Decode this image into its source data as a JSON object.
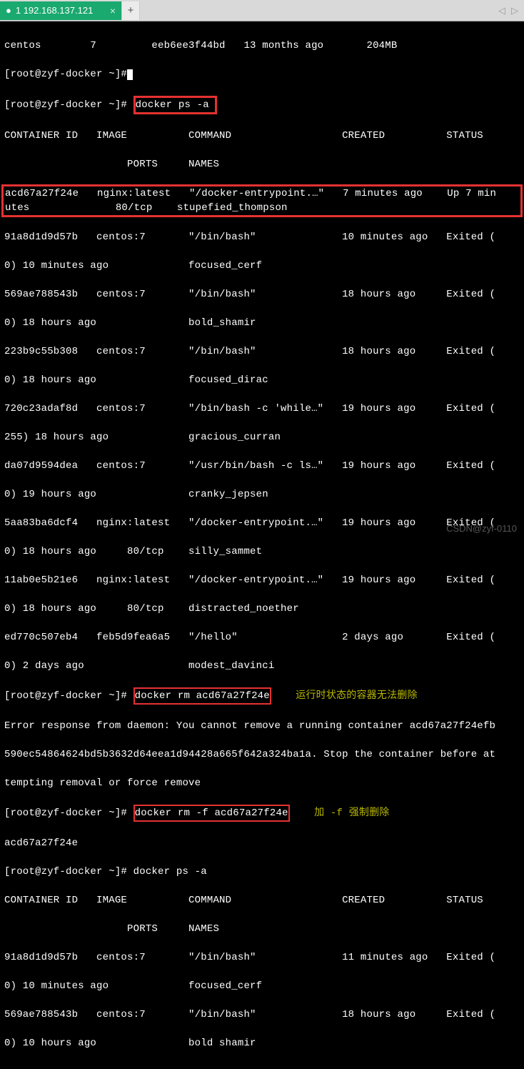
{
  "tab_bar": {
    "active_tab_label": "1 192.168.137.121",
    "add_button": "+",
    "arrow_left": "◁",
    "arrow_right": "▷"
  },
  "terminal": {
    "line_centos": "centos        7         eeb6ee3f44bd   13 months ago       204MB",
    "prompt_idle": "[root@zyf-docker ~]#",
    "cmd_ps_a_boxed": "docker ps -a",
    "header1": "CONTAINER ID   IMAGE          COMMAND                  CREATED          STATUS",
    "header2": "                    PORTS     NAMES",
    "row_hl_a": "acd67a27f24e   nginx:latest   \"/docker-entrypoint.…\"   7 minutes ago    Up 7 min",
    "row_hl_b": "utes              80/tcp    stupefied_thompson",
    "rows_a": [
      "91a8d1d9d57b   centos:7       \"/bin/bash\"              10 minutes ago   Exited (",
      "0) 10 minutes ago             focused_cerf",
      "569ae788543b   centos:7       \"/bin/bash\"              18 hours ago     Exited (",
      "0) 18 hours ago               bold_shamir",
      "223b9c55b308   centos:7       \"/bin/bash\"              18 hours ago     Exited (",
      "0) 18 hours ago               focused_dirac",
      "720c23adaf8d   centos:7       \"/bin/bash -c 'while…\"   19 hours ago     Exited (",
      "255) 18 hours ago             gracious_curran",
      "da07d9594dea   centos:7       \"/usr/bin/bash -c ls…\"   19 hours ago     Exited (",
      "0) 19 hours ago               cranky_jepsen",
      "5aa83ba6dcf4   nginx:latest   \"/docker-entrypoint.…\"   19 hours ago     Exited (",
      "0) 18 hours ago     80/tcp    silly_sammet",
      "11ab0e5b21e6   nginx:latest   \"/docker-entrypoint.…\"   19 hours ago     Exited (",
      "0) 18 hours ago     80/tcp    distracted_noether",
      "ed770c507eb4   feb5d9fea6a5   \"/hello\"                 2 days ago       Exited (",
      "0) 2 days ago                 modest_davinci"
    ],
    "prompt_rm": "[root@zyf-docker ~]# ",
    "cmd_rm_boxed": "docker rm acd67a27f24e",
    "annot_rm_cn": "运行时状态的容器无法删除",
    "error_lines": [
      "Error response from daemon: You cannot remove a running container acd67a27f24efb",
      "590ec54864624bd5b3632d64eea1d94428a665f642a324ba1a. Stop the container before at",
      "tempting removal or force remove"
    ],
    "prompt_rm_f": "[root@zyf-docker ~]# ",
    "cmd_rm_f_boxed": "docker rm -f acd67a27f24e",
    "annot_rm_f_cn": "加 -f 强制删除",
    "echo_id": "acd67a27f24e",
    "cmd_ps_a2": "[root@zyf-docker ~]# docker ps -a",
    "header1b": "CONTAINER ID   IMAGE          COMMAND                  CREATED          STATUS",
    "header2b": "                    PORTS     NAMES",
    "rows_b": [
      "91a8d1d9d57b   centos:7       \"/bin/bash\"              11 minutes ago   Exited (",
      "0) 10 minutes ago             focused_cerf",
      "569ae788543b   centos:7       \"/bin/bash\"              18 hours ago     Exited ("
    ],
    "cutoff": "0) 10 hours ago               bold shamir"
  },
  "watermark": "CSDN@zyf-0110"
}
